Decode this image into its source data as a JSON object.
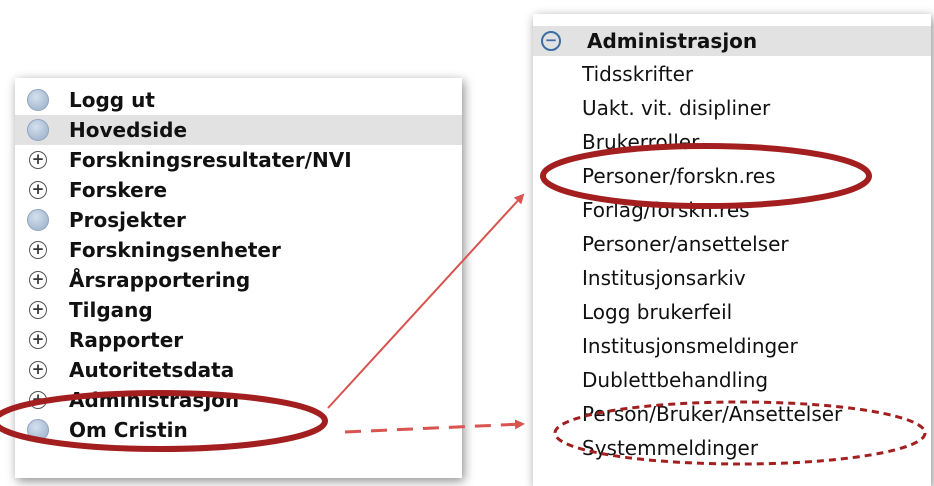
{
  "left_menu": {
    "items": [
      {
        "label": "Logg ut",
        "icon": "dot-icon"
      },
      {
        "label": "Hovedside",
        "icon": "dot-icon",
        "selected": true
      },
      {
        "label": "Forskningsresultater/NVI",
        "icon": "plus-icon"
      },
      {
        "label": "Forskere",
        "icon": "plus-icon"
      },
      {
        "label": "Prosjekter",
        "icon": "dot-icon"
      },
      {
        "label": "Forskningsenheter",
        "icon": "plus-icon"
      },
      {
        "label": "Årsrapportering",
        "icon": "plus-icon"
      },
      {
        "label": "Tilgang",
        "icon": "plus-icon"
      },
      {
        "label": "Rapporter",
        "icon": "plus-icon"
      },
      {
        "label": "Autoritetsdata",
        "icon": "plus-icon"
      },
      {
        "label": "Administrasjon",
        "icon": "plus-icon"
      },
      {
        "label": "Om Cristin",
        "icon": "dot-icon"
      }
    ]
  },
  "right_menu": {
    "header": "Administrasjon",
    "items": [
      "Tidsskrifter",
      "Uakt. vit. disipliner",
      "Brukerroller",
      "Personer/forskn.res",
      "Forlag/forskn.res",
      "Personer/ansettelser",
      "Institusjonsarkiv",
      "Logg brukerfeil",
      "Institusjonsmeldinger",
      "Dublettbehandling",
      "Person/Bruker/Ansettelser",
      "Systemmeldinger"
    ]
  },
  "colors": {
    "highlight_ellipse": "#a31f1f",
    "arrow": "#d9534f",
    "selected_bg": "#e2e2e2"
  }
}
